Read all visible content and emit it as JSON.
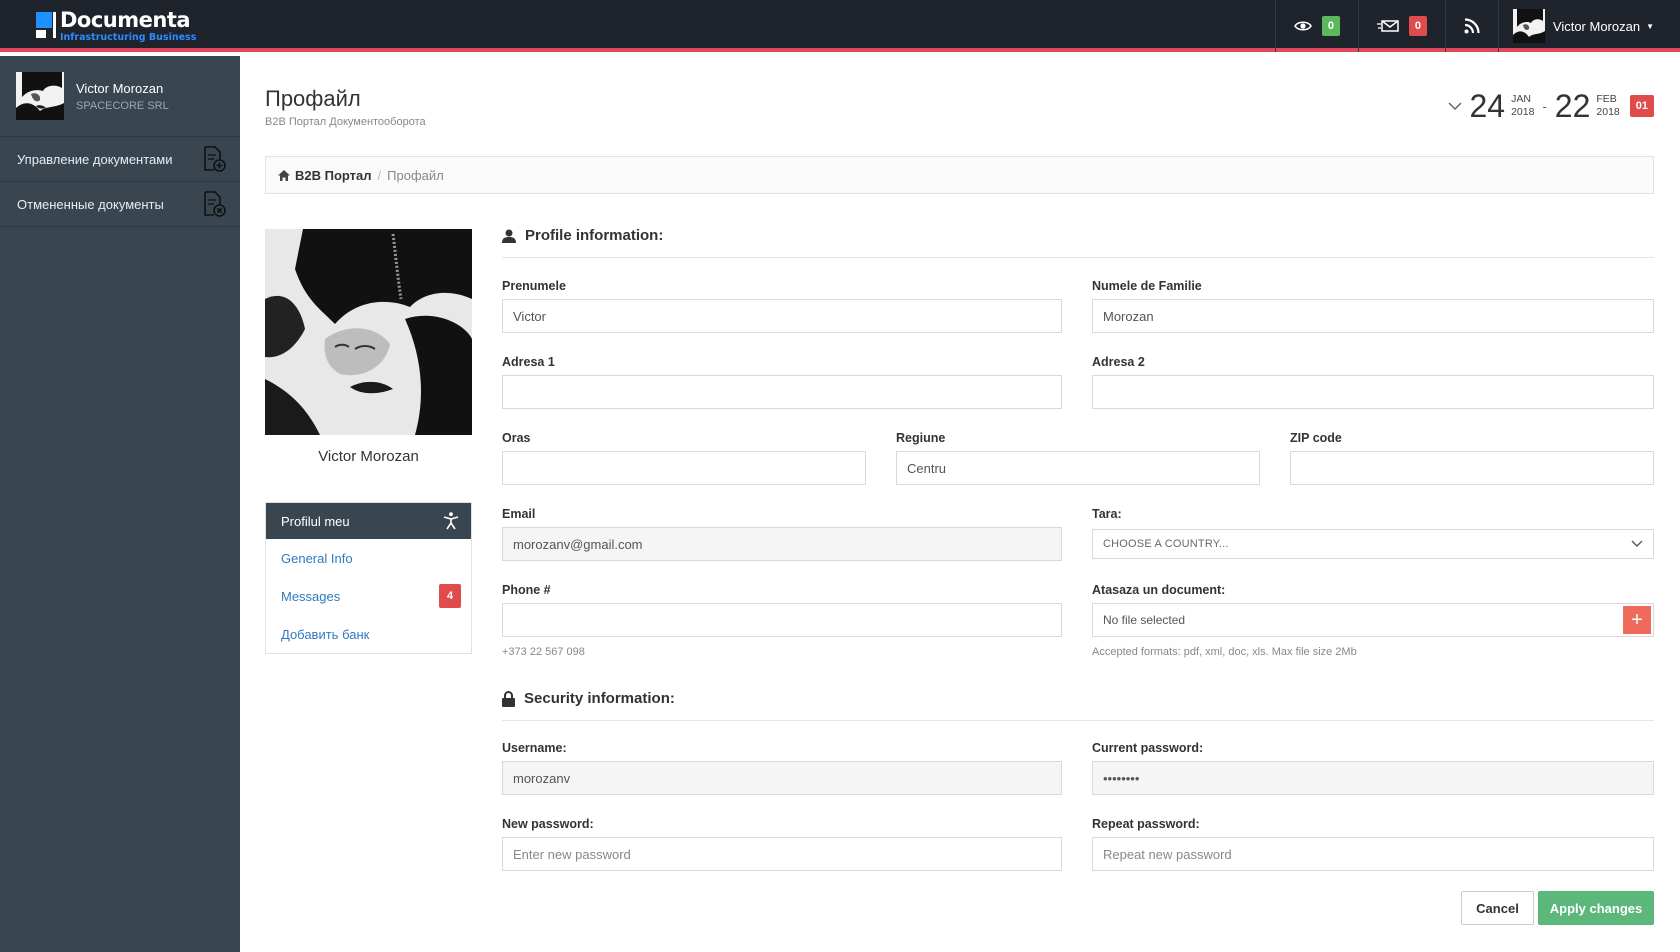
{
  "app": {
    "logo_title": "Documenta",
    "logo_subtitle": "Infrastructuring Business",
    "accent_color": "#e0485a"
  },
  "topbar": {
    "views_count": "0",
    "messages_count": "0",
    "user_name": "Victor Morozan"
  },
  "sidebar": {
    "user_name": "Victor Morozan",
    "company": "SPACECORE SRL",
    "items": [
      {
        "label": "Управление документами",
        "icon": "document-add-icon"
      },
      {
        "label": "Отмененные документы",
        "icon": "document-cancel-icon"
      }
    ]
  },
  "page": {
    "title": "Профайл",
    "subtitle": "B2B Портал Документооборота"
  },
  "date_range": {
    "start_day": "24",
    "start_month": "JAN",
    "start_year": "2018",
    "separator": "-",
    "end_day": "22",
    "end_month": "FEB",
    "end_year": "2018",
    "badge": "01"
  },
  "breadcrumb": {
    "home": "B2B Портал",
    "separator": "/",
    "current": "Профайл"
  },
  "profile": {
    "name": "Victor Morozan",
    "menu_title": "Profilul meu",
    "menu_items": [
      {
        "label": "General Info"
      },
      {
        "label": "Messages",
        "badge": "4"
      },
      {
        "label": "Добавить банк"
      }
    ]
  },
  "form": {
    "profile_section": "Profile information:",
    "first_name": {
      "label": "Prenumele",
      "value": "Victor"
    },
    "last_name": {
      "label": "Numele de Familie",
      "value": "Morozan"
    },
    "address1": {
      "label": "Adresa 1",
      "value": ""
    },
    "address2": {
      "label": "Adresa 2",
      "value": ""
    },
    "city": {
      "label": "Oras",
      "value": ""
    },
    "region": {
      "label": "Regiune",
      "value": "Centru"
    },
    "zip": {
      "label": "ZIP code",
      "value": ""
    },
    "email": {
      "label": "Email",
      "value": "morozanv@gmail.com"
    },
    "country": {
      "label": "Tara:",
      "selected": "CHOOSE A COUNTRY..."
    },
    "phone": {
      "label": "Phone #",
      "value": "",
      "help": "+373 22 567 098"
    },
    "attach": {
      "label": "Atasaza un document:",
      "value": "No file selected",
      "help": "Accepted formats: pdf, xml, doc, xls. Max file size 2Mb"
    },
    "security_section": "Security information:",
    "username": {
      "label": "Username:",
      "value": "morozanv"
    },
    "current_password": {
      "label": "Current password:",
      "value": "••••••••"
    },
    "new_password": {
      "label": "New password:",
      "placeholder": "Enter new password"
    },
    "repeat_password": {
      "label": "Repeat password:",
      "placeholder": "Repeat new password"
    },
    "cancel_label": "Cancel",
    "apply_label": "Apply changes"
  }
}
